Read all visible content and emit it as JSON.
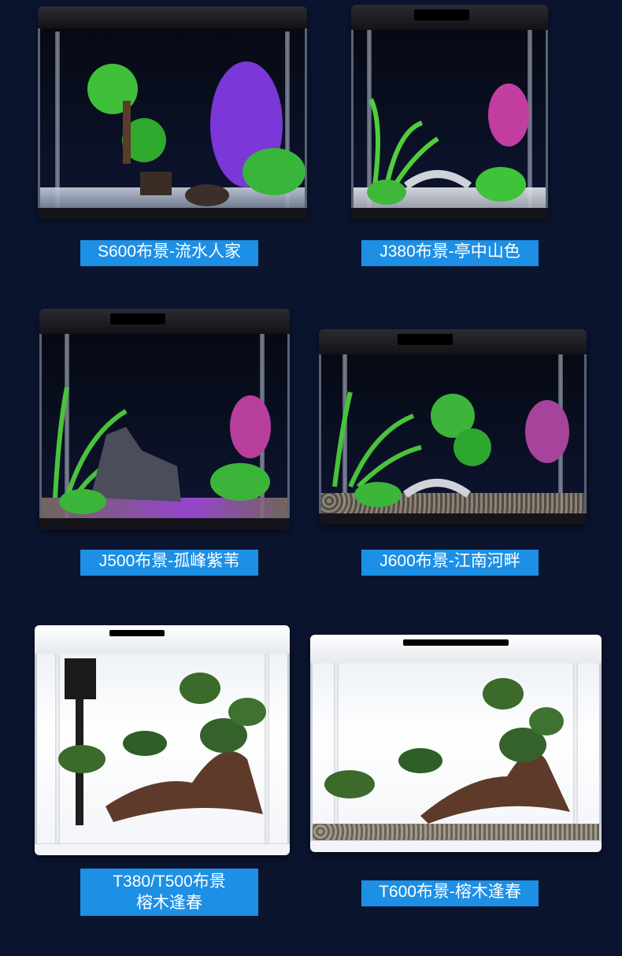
{
  "items": [
    {
      "label": "S600布景-流水人家",
      "style": "dark"
    },
    {
      "label": "J380布景-亭中山色",
      "style": "dark"
    },
    {
      "label": "J500布景-孤峰紫苇",
      "style": "dark"
    },
    {
      "label": "J600布景-江南河畔",
      "style": "dark"
    },
    {
      "label_line1": "T380/T500布景",
      "label_line2": "榕木逢春",
      "style": "white"
    },
    {
      "label": "T600布景-榕木逢春",
      "style": "white"
    }
  ],
  "colors": {
    "background": "#0b1530",
    "label_bg": "#1d8fe5",
    "label_text": "#ffffff"
  }
}
